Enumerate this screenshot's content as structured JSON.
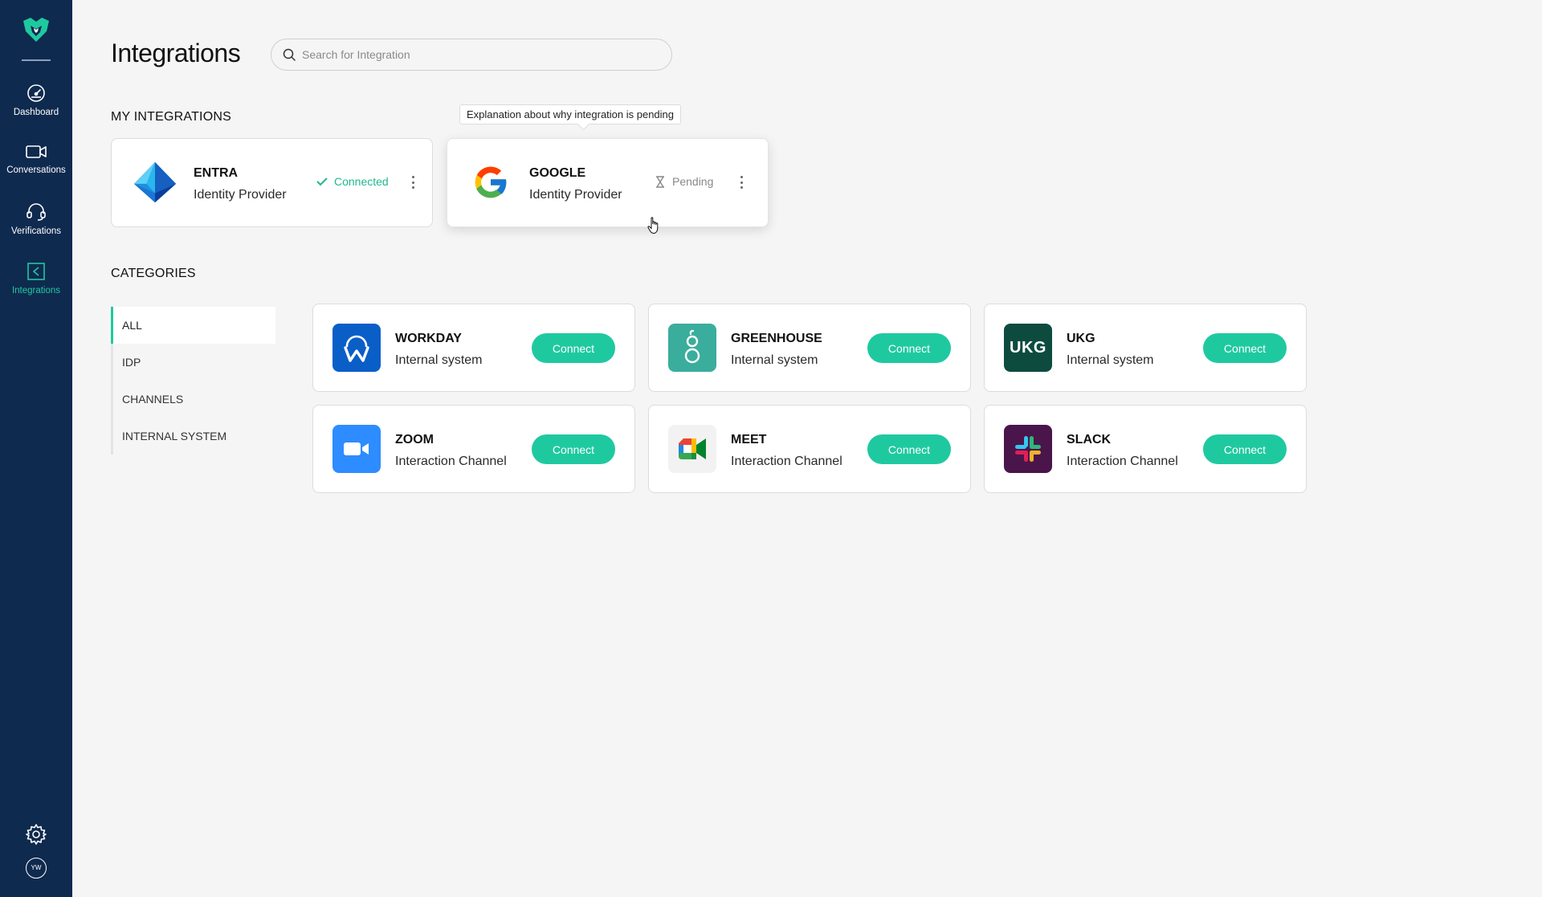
{
  "sidebar": {
    "nav": [
      {
        "label": "Dashboard",
        "icon": "gauge-icon",
        "active": false
      },
      {
        "label": "Conversations",
        "icon": "video-camera-icon",
        "active": false
      },
      {
        "label": "Verifications",
        "icon": "headset-icon",
        "active": false
      },
      {
        "label": "Integrations",
        "icon": "integrations-icon",
        "active": true
      }
    ],
    "avatar_initials": "YW"
  },
  "header": {
    "title": "Integrations",
    "search_placeholder": "Search for Integration"
  },
  "my_integrations": {
    "title": "MY INTEGRATIONS",
    "tooltip": "Explanation about why integration is pending",
    "items": [
      {
        "name": "ENTRA",
        "type": "Identity Provider",
        "status": "Connected"
      },
      {
        "name": "GOOGLE",
        "type": "Identity Provider",
        "status": "Pending"
      }
    ]
  },
  "categories": {
    "title": "CATEGORIES",
    "items": [
      "ALL",
      "IDP",
      "CHANNELS",
      "INTERNAL SYSTEM"
    ],
    "active": "ALL"
  },
  "catalog": {
    "connect_label": "Connect",
    "items": [
      {
        "name": "WORKDAY",
        "type": "Internal system"
      },
      {
        "name": "GREENHOUSE",
        "type": "Internal system"
      },
      {
        "name": "UKG",
        "type": "Internal system",
        "logo_text": "UKG"
      },
      {
        "name": "ZOOM",
        "type": "Interaction Channel"
      },
      {
        "name": "MEET",
        "type": "Interaction Channel"
      },
      {
        "name": "SLACK",
        "type": "Interaction Channel"
      }
    ]
  },
  "colors": {
    "sidebar_bg": "#0f2a4f",
    "accent": "#1fc9a0",
    "pending": "#888888"
  }
}
